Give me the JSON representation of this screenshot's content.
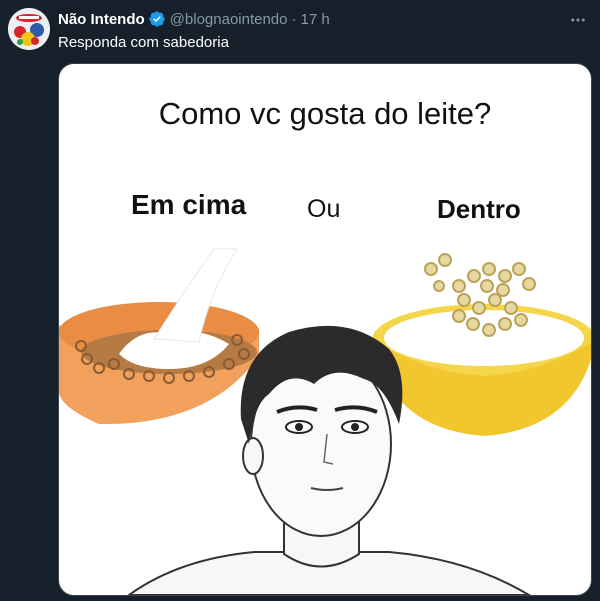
{
  "tweet": {
    "author_name": "Não Intendo",
    "handle": "@blognaointendo",
    "separator": "·",
    "time": "17 h",
    "text": "Responda com sabedoria"
  },
  "meme": {
    "title": "Como vc gosta do leite?",
    "left_label": "Em cima",
    "middle_label": "Ou",
    "right_label": "Dentro"
  },
  "icons": {
    "verified": "verified-badge-icon",
    "more": "more-options-icon"
  },
  "colors": {
    "background": "#15202b",
    "secondary_text": "#8b98a5",
    "verified": "#1d9bf0",
    "bowl_left": "#f2a15c",
    "bowl_right": "#f5d54a"
  }
}
